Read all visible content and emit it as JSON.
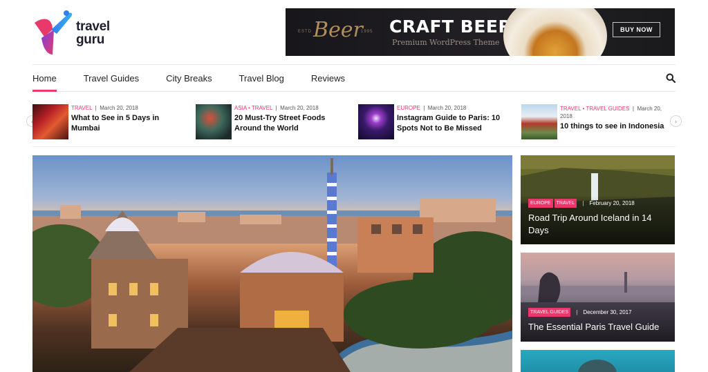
{
  "brand": {
    "name_line1": "travel",
    "name_line2": "guru",
    "colors": {
      "accent": "#e8396b",
      "logo_purple": "#7b3fe4",
      "logo_blue": "#2f7ff0",
      "logo_pink": "#e8396b"
    }
  },
  "ad": {
    "estd": "ESTD",
    "year": "1995",
    "script": "Beer",
    "title": "CRAFT BEER",
    "subtitle": "Premium WordPress Theme",
    "button": "BUY NOW"
  },
  "nav": {
    "items": [
      {
        "label": "Home",
        "active": true
      },
      {
        "label": "Travel Guides",
        "active": false
      },
      {
        "label": "City Breaks",
        "active": false
      },
      {
        "label": "Travel Blog",
        "active": false
      },
      {
        "label": "Reviews",
        "active": false
      }
    ],
    "search_icon": "search-icon"
  },
  "ticker": {
    "prev_icon": "chevron-left-icon",
    "next_icon": "chevron-right-icon",
    "items": [
      {
        "categories": "TRAVEL",
        "date": "March 20, 2018",
        "title": "What to See in 5 Days in Mumbai"
      },
      {
        "categories": "ASIA • TRAVEL",
        "date": "March 20, 2018",
        "title": "20 Must-Try Street Foods Around the World"
      },
      {
        "categories": "EUROPE",
        "date": "March 20, 2018",
        "title": "Instagram Guide to Paris: 10 Spots Not to Be Missed"
      },
      {
        "categories": "TRAVEL • TRAVEL GUIDES",
        "date": "March 20, 2018",
        "title": "10 things to see in Indonesia"
      }
    ]
  },
  "side_cards": [
    {
      "badges": [
        "EUROPE",
        "TRAVEL"
      ],
      "date": "February 20, 2018",
      "title": "Road Trip Around Iceland in 14 Days"
    },
    {
      "badges": [
        "TRAVEL GUIDES"
      ],
      "date": "December 30, 2017",
      "title": "The Essential Paris Travel Guide"
    }
  ]
}
